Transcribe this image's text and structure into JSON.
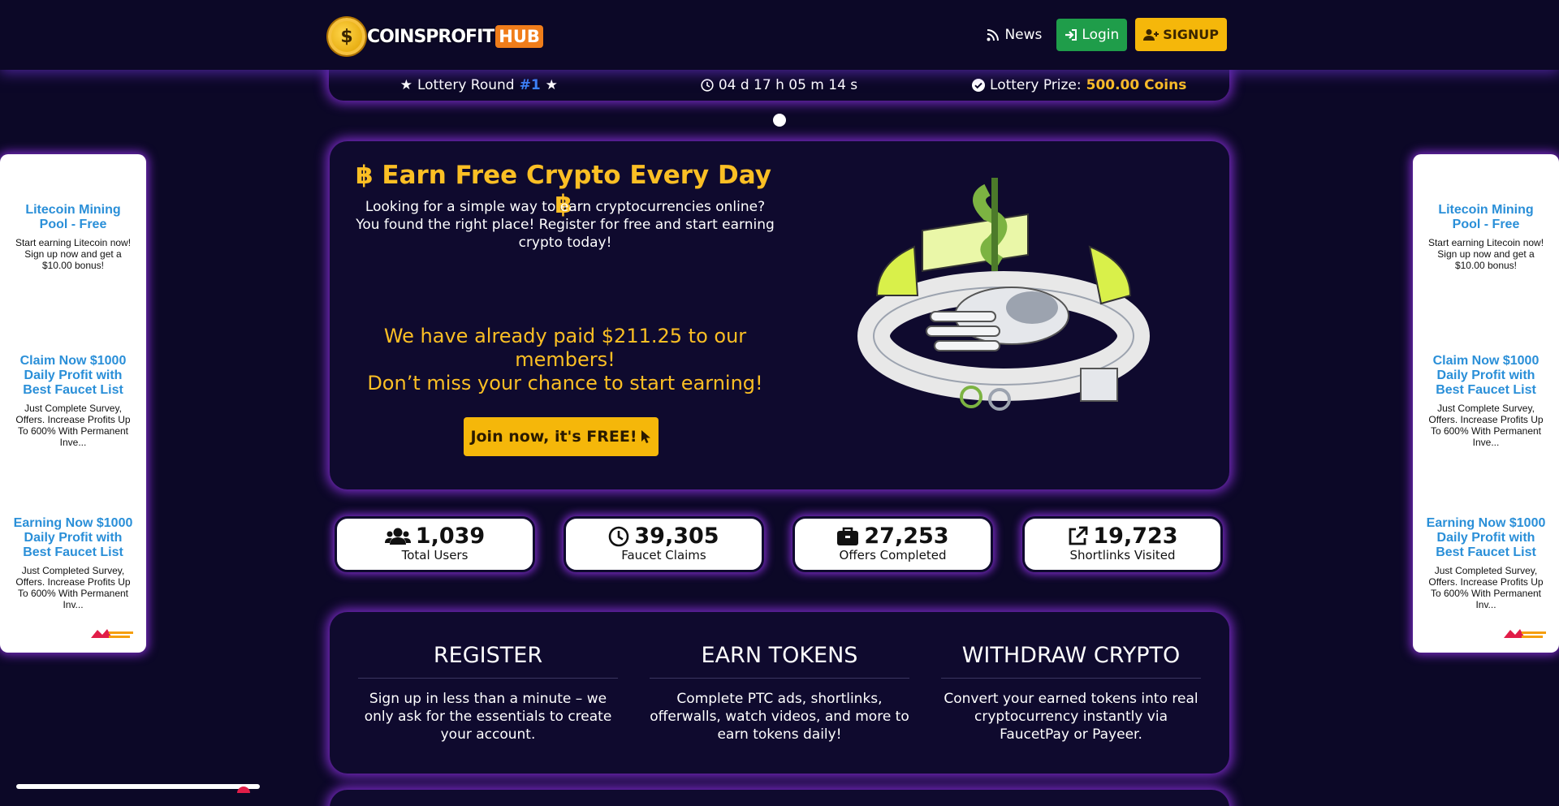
{
  "header": {
    "logo_text": "COINSPROFIT",
    "logo_hub": "HUB",
    "logo_coin_symbol": "$",
    "nav": {
      "news": "News",
      "login": "Login",
      "signup": "SIGNUP"
    }
  },
  "lottery": {
    "round_label": "Lottery Round",
    "round_number": "#1",
    "countdown": "04 d 17 h 05 m 14 s",
    "prize_label": "Lottery Prize:",
    "prize_value": "500.00 Coins"
  },
  "hero": {
    "title": "Earn Free Crypto Every Day",
    "title_symbol": "฿",
    "description": "Looking for a simple way to earn cryptocurrencies online? You found the right place! Register for free and start earning crypto today!",
    "paid_line1": "We have already paid $211.25 to our members!",
    "paid_line2": "Don’t miss your chance to start earning!",
    "cta": "Join now, it's FREE!"
  },
  "ads": {
    "items": [
      {
        "title": "Litecoin Mining Pool - Free",
        "text": "Start earning Litecoin now! Sign up now and get a $10.00 bonus!"
      },
      {
        "title": "Claim Now $1000 Daily Profit with Best Faucet List",
        "text": "Just Complete Survey, Offers. Increase Profits Up To 600% With Permanent Inve..."
      },
      {
        "title": "Earning Now $1000 Daily Profit with Best Faucet List",
        "text": "Just Completed Survey, Offers. Increase Profits Up To 600% With Permanent Inv..."
      }
    ]
  },
  "stats": [
    {
      "icon": "users-icon",
      "value": "1,039",
      "label": "Total Users"
    },
    {
      "icon": "clock-icon",
      "value": "39,305",
      "label": "Faucet Claims"
    },
    {
      "icon": "briefcase-icon",
      "value": "27,253",
      "label": "Offers Completed"
    },
    {
      "icon": "external-link-icon",
      "value": "19,723",
      "label": "Shortlinks Visited"
    }
  ],
  "steps": [
    {
      "title": "REGISTER",
      "text": "Sign up in less than a minute – we only ask for the essentials to create your account."
    },
    {
      "title": "EARN TOKENS",
      "text": "Complete PTC ads, shortlinks, offerwalls, watch videos, and more to earn tokens daily!"
    },
    {
      "title": "WITHDRAW CRYPTO",
      "text": "Convert your earned tokens into real cryptocurrency instantly via FaucetPay or Payeer."
    }
  ],
  "colors": {
    "background": "#0c0827",
    "accent": "#fbbf24",
    "glow": "#9333ea",
    "login": "#1f9d4a",
    "round": "#3b82f6"
  }
}
